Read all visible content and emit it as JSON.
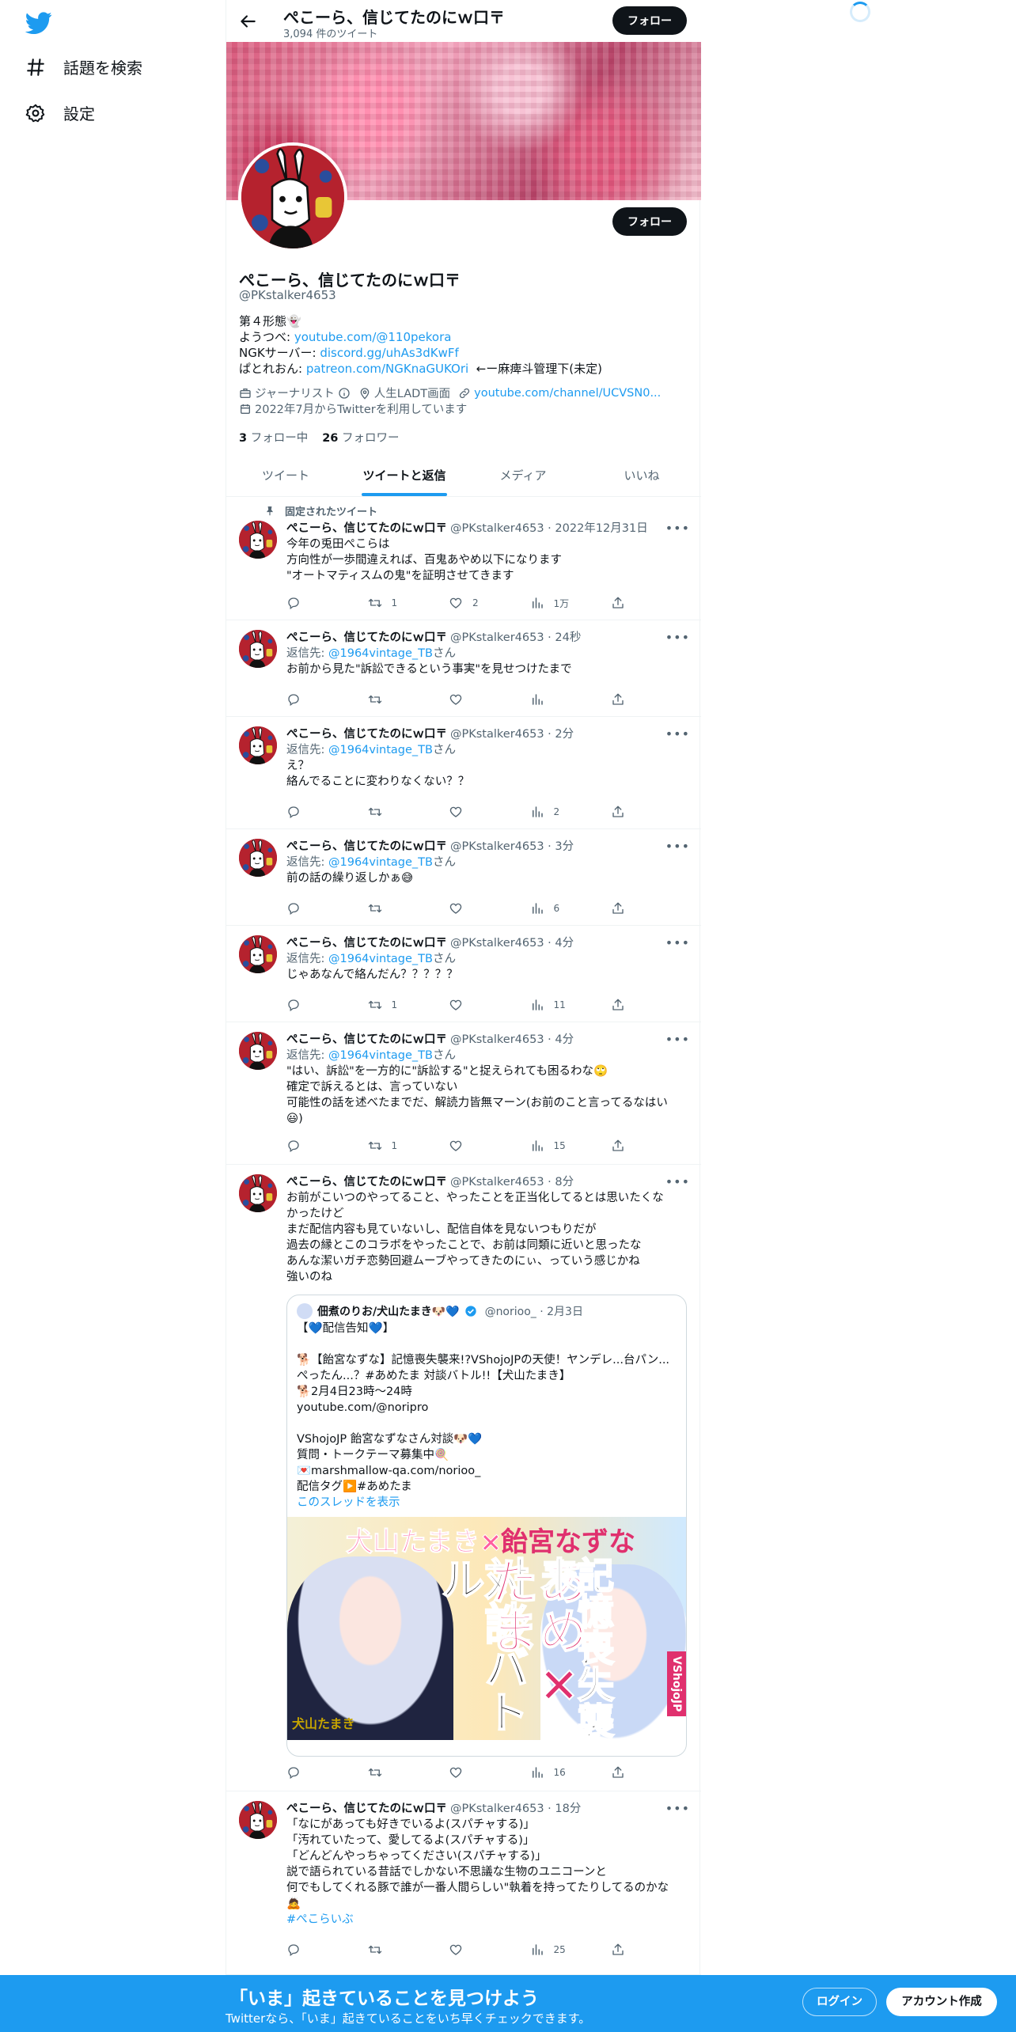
{
  "sidebar": {
    "logo_icon": "twitter-bird-icon",
    "items": [
      {
        "icon": "hashtag-icon",
        "label": "話題を検索"
      },
      {
        "icon": "gear-icon",
        "label": "設定"
      }
    ]
  },
  "header": {
    "title": "ぺこーら、信じてたのにｗ口〒",
    "tweet_count": "3,094 件のツイート",
    "follow_label": "フォロー"
  },
  "profile": {
    "name": "ぺこーら、信じてたのにｗ口〒",
    "handle": "@PKstalker4653",
    "follow_label": "フォロー",
    "bio": {
      "line1": "第４形態👻",
      "line2_prefix": "ようつべ: ",
      "line2_link": "youtube.com/@110pekora",
      "line3_prefix": "NGKサーバー: ",
      "line3_link": "discord.gg/uhAs3dKwFf",
      "line4_prefix": "ぱとれおん: ",
      "line4_link": "patreon.com/NGKnaGUKOri",
      "line4_suffix": "  ←ー麻痺斗管理下(未定)"
    },
    "category": "ジャーナリスト",
    "location": "人生LADT画面",
    "website": "youtube.com/channel/UCVSN0...",
    "joined": "2022年7月からTwitterを利用しています",
    "following_count": "3",
    "following_label": "フォロー中",
    "followers_count": "26",
    "followers_label": "フォロワー"
  },
  "tabs": [
    {
      "label": "ツイート",
      "active": false
    },
    {
      "label": "ツイートと返信",
      "active": true
    },
    {
      "label": "メディア",
      "active": false
    },
    {
      "label": "いいね",
      "active": false
    }
  ],
  "tweets": [
    {
      "pinned_label": "固定されたツイート",
      "name": "ぺこーら、信じてたのにｗ口〒",
      "meta": "@PKstalker4653 · 2022年12月31日",
      "text": "今年の兎田ぺこらは\n方向性が一歩間違えれば、百鬼あやめ以下になります\n\"オートマティスムの鬼\"を証明させてきます",
      "retweets": "1",
      "likes": "2",
      "views": "1万"
    },
    {
      "name": "ぺこーら、信じてたのにｗ口〒",
      "meta": "@PKstalker4653 · 24秒",
      "reply_prefix": "返信先: ",
      "reply_user": "@1964vintage_TB",
      "reply_suffix": "さん",
      "text": "お前から見た\"訴訟できるという事実\"を見せつけたまで",
      "retweets": "",
      "likes": "",
      "views": ""
    },
    {
      "name": "ぺこーら、信じてたのにｗ口〒",
      "meta": "@PKstalker4653 · 2分",
      "reply_prefix": "返信先: ",
      "reply_user": "@1964vintage_TB",
      "reply_suffix": "さん",
      "text": "え？\n絡んでることに変わりなくない？？",
      "retweets": "",
      "likes": "",
      "views": "2"
    },
    {
      "name": "ぺこーら、信じてたのにｗ口〒",
      "meta": "@PKstalker4653 · 3分",
      "reply_prefix": "返信先: ",
      "reply_user": "@1964vintage_TB",
      "reply_suffix": "さん",
      "text": "前の話の繰り返しかぁ😅",
      "retweets": "",
      "likes": "",
      "views": "6"
    },
    {
      "name": "ぺこーら、信じてたのにｗ口〒",
      "meta": "@PKstalker4653 · 4分",
      "reply_prefix": "返信先: ",
      "reply_user": "@1964vintage_TB",
      "reply_suffix": "さん",
      "text": "じゃあなんで絡んだん？？？？？",
      "retweets": "1",
      "likes": "",
      "views": "11"
    },
    {
      "name": "ぺこーら、信じてたのにｗ口〒",
      "meta": "@PKstalker4653 · 4分",
      "reply_prefix": "返信先: ",
      "reply_user": "@1964vintage_TB",
      "reply_suffix": "さん",
      "text": "\"はい、訴訟\"を一方的に\"訴訟する\"と捉えられても困るわな🙄\n確定で訴えるとは、言っていない\n可能性の話を述べたまでだ、解読力皆無マーン(お前のこと言ってるなはい\n😃)",
      "retweets": "1",
      "likes": "",
      "views": "15"
    },
    {
      "name": "ぺこーら、信じてたのにｗ口〒",
      "meta": "@PKstalker4653 · 8分",
      "text": "お前がこいつのやってること、やったことを正当化してるとは思いたくな\nかったけど\nまだ配信内容も見ていないし、配信自体を見ないつもりだが\n過去の縁とこのコラボをやったことで、お前は同類に近いと思ったな\nあんな潔いガチ恋勢回避ムーブやってきたのにぃ、っていう感じかね\n強いのね",
      "quote": {
        "name": "佃煮のりお/犬山たまき🐶💙",
        "meta": "@norioo_ · 2月3日",
        "text": "【💙配信告知💙】\n\n🐕【飴宮なずな】記憶喪失襲来!?VShojoJPの天使！ヤンデレ...台パン...ぺったん...？#あめたま 対談バトル!!【犬山たまき】\n🐕2月4日23時～24時\nyoutube.com/@noripro\n\nVShojoJP 飴宮なずなさん対談🐶💙\n質問・トークテーマ募集中🍭\n💌marshmallow-qa.com/norioo_\n配信タグ▶️#あめたま",
        "thread_link": "このスレッドを表示",
        "image_title_left": "犬山たまき×",
        "image_title_right": "飴宮なずな",
        "image_v1": "対談バトル",
        "image_v2": "あめ×たま",
        "image_v3": "記憶喪失襲来",
        "image_badge": "VShojoJP",
        "image_logo": "犬山たまき"
      },
      "retweets": "",
      "likes": "",
      "views": "16"
    },
    {
      "name": "ぺこーら、信じてたのにｗ口〒",
      "meta": "@PKstalker4653 · 18分",
      "text": "「なにがあっても好きでいるよ(スパチャする)」\n「汚れていたって、愛してるよ(スパチャする)」\n「どんどんやっちゃってください(スパチャする)」\n説で語られている昔話でしかない不思議な生物のユニコーンと\n何でもしてくれる豚で誰が一番人間らしい\"執着を持ってたりしてるのかな\n🙇",
      "hashtag": "#ぺこらいぶ",
      "retweets": "",
      "likes": "",
      "views": "25"
    }
  ],
  "bottom_bar": {
    "title": "「いま」起きていることを見つけよう",
    "subtitle": "Twitterなら、「いま」起きていることをいち早くチェックできます。",
    "login_label": "ログイン",
    "signup_label": "アカウント作成"
  },
  "colors": {
    "accent": "#1d9bf0",
    "text": "#0f1419",
    "muted": "#536471",
    "avatar_bg": "#b5222e"
  }
}
